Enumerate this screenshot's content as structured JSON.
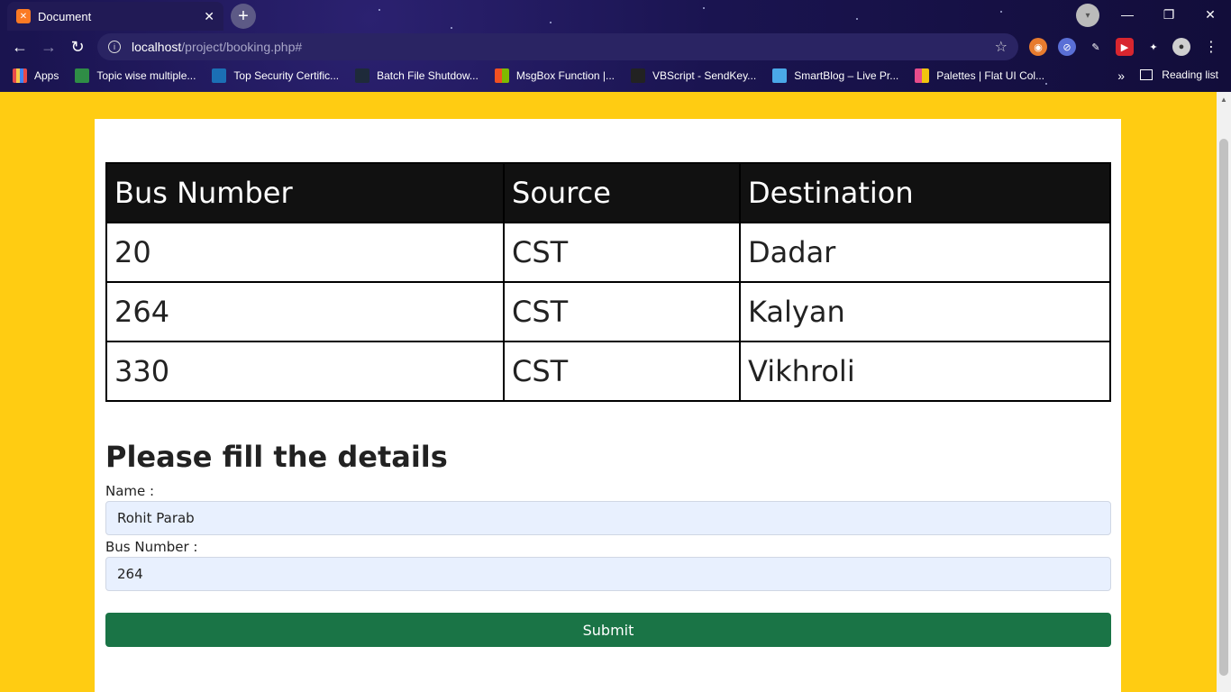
{
  "browser": {
    "tab_title": "Document",
    "tab_close": "✕",
    "new_tab": "+",
    "url_host": "localhost",
    "url_path": "/project/booking.php#",
    "bookmarks": [
      {
        "label": "Apps",
        "color": "#e84a4a"
      },
      {
        "label": "Topic wise multiple...",
        "color": "#2f8d46"
      },
      {
        "label": "Top Security Certific...",
        "color": "#1b6fb5"
      },
      {
        "label": "Batch File Shutdow...",
        "color": "#1e2a3a"
      },
      {
        "label": "MsgBox Function |...",
        "color": "#f25022"
      },
      {
        "label": "VBScript - SendKey...",
        "color": "#222222"
      },
      {
        "label": "SmartBlog – Live Pr...",
        "color": "#4aa8e8"
      },
      {
        "label": "Palettes | Flat UI Col...",
        "color": "#e74c8b"
      }
    ],
    "more_bookmarks": "»",
    "reading_list": "Reading list"
  },
  "table": {
    "headers": [
      "Bus Number",
      "Source",
      "Destination"
    ],
    "rows": [
      [
        "20",
        "CST",
        "Dadar"
      ],
      [
        "264",
        "CST",
        "Kalyan"
      ],
      [
        "330",
        "CST",
        "Vikhroli"
      ]
    ]
  },
  "form": {
    "title": "Please fill the details",
    "name_label": "Name :",
    "name_value": "Rohit Parab",
    "bus_label": "Bus Number :",
    "bus_value": "264",
    "submit_label": "Submit"
  },
  "colors": {
    "page_background": "#ffcc12",
    "submit_background": "#1a7446",
    "table_header_background": "#111111",
    "input_background": "#e8f0fe"
  }
}
